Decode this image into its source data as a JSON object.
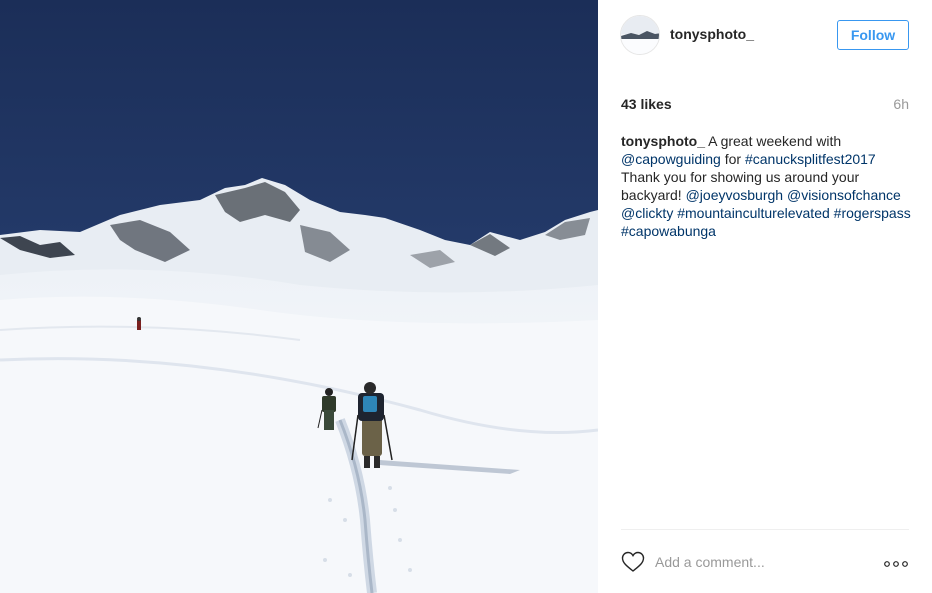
{
  "post": {
    "username": "tonysphoto_",
    "follow_label": "Follow",
    "likes": "43 likes",
    "time": "6h",
    "caption": {
      "user": "tonysphoto_",
      "t1": " A great weekend with ",
      "l1": "@capowguiding",
      "t2": " for ",
      "l2": "#canucksplitfest2017",
      "t3": " Thank you for showing us around your backyard! ",
      "l3": "@joeyvosburgh",
      "t4": " ",
      "l4": "@visionsofchance",
      "t5": " ",
      "l5": "@clickty",
      "t6": " ",
      "l6": "#mountainculturelevated",
      "t7": " ",
      "l7": "#rogerspass",
      "t8": " ",
      "l8": "#capowabunga"
    },
    "comment_placeholder": "Add a comment..."
  },
  "icons": {
    "heart": "heart-icon",
    "more": "more-options-icon"
  },
  "colors": {
    "link": "#003569",
    "follow": "#3897f0",
    "sky": "#223a6a"
  }
}
